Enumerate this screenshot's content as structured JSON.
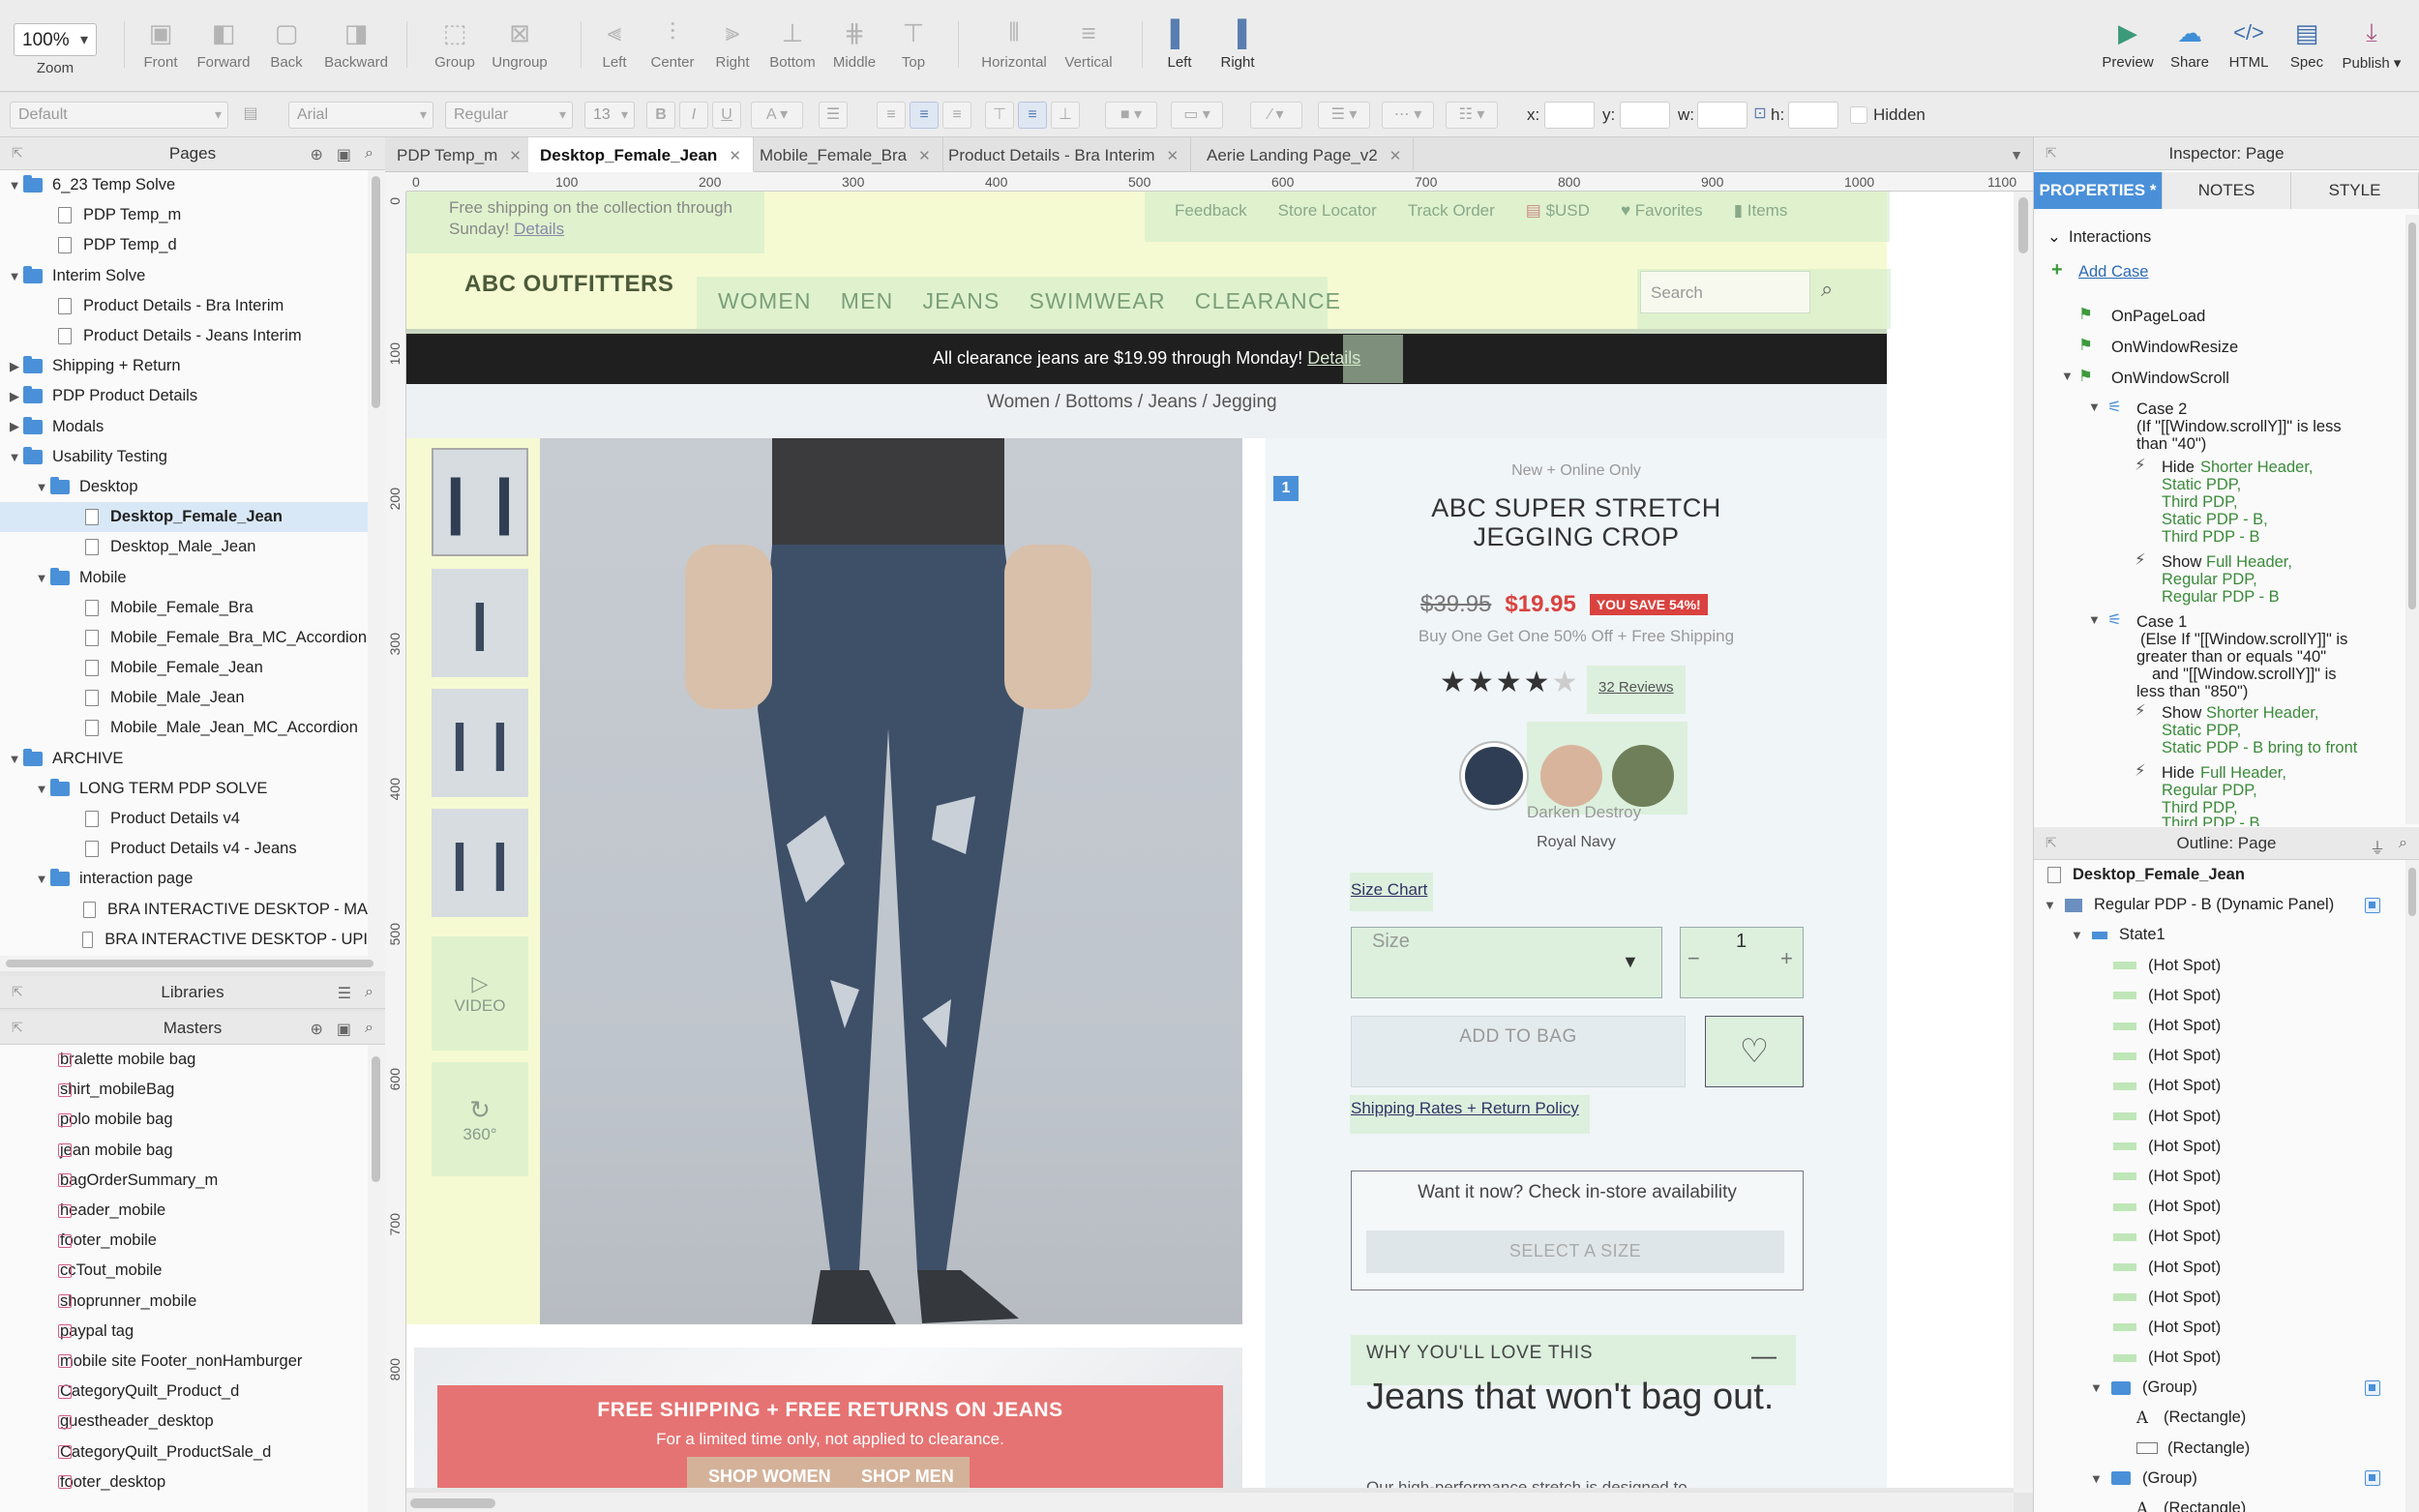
{
  "toolbar": {
    "zoom_value": "100%",
    "zoom_label": "Zoom",
    "arrange": [
      "Front",
      "Forward",
      "Back",
      "Backward"
    ],
    "group": [
      "Group",
      "Ungroup"
    ],
    "align": [
      "Left",
      "Center",
      "Right",
      "Bottom",
      "Middle",
      "Top"
    ],
    "distribute": [
      "Horizontal",
      "Vertical"
    ],
    "adaptive": [
      "Left",
      "Right"
    ],
    "publish": [
      "Preview",
      "Share",
      "HTML",
      "Spec",
      "Publish ▾"
    ]
  },
  "formatbar": {
    "style": "Default",
    "font": "Arial",
    "weight": "Regular",
    "size": "13",
    "x_label": "x:",
    "y_label": "y:",
    "w_label": "w:",
    "h_label": "h:",
    "hidden_label": "Hidden"
  },
  "pages_panel": {
    "title": "Pages",
    "items": [
      {
        "label": "6_23 Temp Solve",
        "level": 0,
        "type": "folder",
        "open": true
      },
      {
        "label": "PDP Temp_m",
        "level": 1,
        "type": "page"
      },
      {
        "label": "PDP Temp_d",
        "level": 1,
        "type": "page"
      },
      {
        "label": "Interim Solve",
        "level": 0,
        "type": "folder",
        "open": true
      },
      {
        "label": "Product Details - Bra Interim",
        "level": 1,
        "type": "page"
      },
      {
        "label": "Product Details - Jeans Interim",
        "level": 1,
        "type": "page"
      },
      {
        "label": "Shipping + Return",
        "level": 0,
        "type": "folder",
        "open": false
      },
      {
        "label": "PDP Product Details",
        "level": 0,
        "type": "folder",
        "open": false
      },
      {
        "label": "Modals",
        "level": 0,
        "type": "folder",
        "open": false
      },
      {
        "label": "Usability Testing",
        "level": 0,
        "type": "folder",
        "open": true
      },
      {
        "label": "Desktop",
        "level": 1,
        "type": "folder",
        "open": true
      },
      {
        "label": "Desktop_Female_Jean",
        "level": 2,
        "type": "page",
        "selected": true
      },
      {
        "label": "Desktop_Male_Jean",
        "level": 2,
        "type": "page"
      },
      {
        "label": "Mobile",
        "level": 1,
        "type": "folder",
        "open": true
      },
      {
        "label": "Mobile_Female_Bra",
        "level": 2,
        "type": "page"
      },
      {
        "label": "Mobile_Female_Bra_MC_Accordion",
        "level": 2,
        "type": "page"
      },
      {
        "label": "Mobile_Female_Jean",
        "level": 2,
        "type": "page"
      },
      {
        "label": "Mobile_Male_Jean",
        "level": 2,
        "type": "page"
      },
      {
        "label": "Mobile_Male_Jean_MC_Accordion",
        "level": 2,
        "type": "page"
      },
      {
        "label": "ARCHIVE",
        "level": 0,
        "type": "folder",
        "open": true
      },
      {
        "label": "LONG TERM PDP SOLVE",
        "level": 1,
        "type": "folder",
        "open": true
      },
      {
        "label": "Product Details v4",
        "level": 2,
        "type": "page"
      },
      {
        "label": "Product Details v4 - Jeans",
        "level": 2,
        "type": "page"
      },
      {
        "label": "interaction page",
        "level": 1,
        "type": "folder",
        "open": true
      },
      {
        "label": "BRA INTERACTIVE DESKTOP - MA",
        "level": 2,
        "type": "page"
      },
      {
        "label": "BRA INTERACTIVE DESKTOP - UPI",
        "level": 2,
        "type": "page"
      }
    ]
  },
  "libraries_panel": {
    "title": "Libraries"
  },
  "masters_panel": {
    "title": "Masters",
    "items": [
      "bralette mobile bag",
      "shirt_mobileBag",
      "polo mobile bag",
      "jean mobile bag",
      "bagOrderSummary_m",
      "header_mobile",
      "footer_mobile",
      "ccTout_mobile",
      "shoprunner_mobile",
      "paypal tag",
      "mobile site Footer_nonHamburger",
      "CategoryQuilt_Product_d",
      "guestheader_desktop",
      "CategoryQuilt_ProductSale_d",
      "footer_desktop"
    ]
  },
  "tabs": [
    {
      "label": "PDP Temp_m",
      "active": false
    },
    {
      "label": "Desktop_Female_Jean",
      "active": true
    },
    {
      "label": "Mobile_Female_Bra",
      "active": false
    },
    {
      "label": "Product Details - Bra Interim",
      "active": false
    },
    {
      "label": "Aerie Landing Page_v2",
      "active": false
    }
  ],
  "ruler": {
    "h": [
      "0",
      "100",
      "200",
      "300",
      "400",
      "500",
      "600",
      "700",
      "800",
      "900",
      "1000",
      "1100"
    ],
    "v": [
      "0",
      "100",
      "200",
      "300",
      "400",
      "500",
      "600",
      "700",
      "800"
    ]
  },
  "design": {
    "promo_text": "Free shipping on the collection through Sunday!",
    "promo_link": "Details",
    "util_links": [
      "Feedback",
      "Store Locator",
      "Track Order",
      "$USD",
      "Favorites",
      "Items"
    ],
    "logo": "ABC OUTFITTERS",
    "nav": [
      "WOMEN",
      "MEN",
      "JEANS",
      "SWIMWEAR",
      "CLEARANCE"
    ],
    "search_placeholder": "Search",
    "banner_text": "All clearance jeans are $19.99 through Monday!",
    "banner_link": "Details",
    "breadcrumb": "Women / Bottoms / Jeans / Jegging",
    "thumb_video": "VIDEO",
    "thumb_360": "360°",
    "badge": "1",
    "tagline": "New + Online Only",
    "product_title": "ABC SUPER STRETCH JEGGING CROP",
    "price_old": "$39.95",
    "price_new": "$19.95",
    "save": "YOU SAVE 54%!",
    "offer": "Buy One Get One 50% Off + Free Shipping",
    "rating": 4,
    "reviews": "32 Reviews",
    "swatch_hover": "Darken Destroy",
    "swatch_selected": "Royal Navy",
    "size_chart": "Size Chart",
    "size_placeholder": "Size",
    "qty": "1",
    "add_to_bag": "ADD TO BAG",
    "shipping_link": "Shipping Rates + Return Policy",
    "instore_title": "Want it now? Check in-store availability",
    "select_size": "SELECT A SIZE",
    "why_title": "WHY YOU'LL LOVE THIS",
    "why_headline": "Jeans that won't bag out.",
    "why_body": "Our high-performance stretch is designed to",
    "promo2_title": "FREE SHIPPING + FREE RETURNS ON JEANS",
    "promo2_sub": "For a limited time only, not applied to clearance.",
    "promo2_btn1": "SHOP WOMEN",
    "promo2_btn2": "SHOP MEN",
    "colors": {
      "banner": "#1f1f1f",
      "sale": "#d9423f",
      "promo_red": "#e67373",
      "header_yellow": "#f6fad2",
      "hotspot": "#cfeccb"
    }
  },
  "inspector": {
    "title": "Inspector: Page",
    "tabs": [
      "PROPERTIES *",
      "NOTES",
      "STYLE"
    ],
    "section": "Interactions",
    "add_case": "Add Case",
    "events": [
      "OnPageLoad",
      "OnWindowResize",
      "OnWindowScroll"
    ],
    "case2": {
      "title": "Case 2",
      "cond": [
        "(If \"[[Window.scrollY]]\" is less",
        "than \"40\")"
      ],
      "hide_label": "Hide",
      "hide_items": [
        "Shorter Header,",
        "Static PDP,",
        "Third PDP,",
        "Static PDP - B,",
        "Third PDP - B"
      ],
      "show_label": "Show",
      "show_items": [
        "Full Header,",
        "Regular PDP,",
        "Regular PDP - B"
      ]
    },
    "case1": {
      "title": "Case 1",
      "cond": [
        "(Else If \"[[Window.scrollY]]\" is",
        "greater than or equals \"40\"",
        "and \"[[Window.scrollY]]\" is",
        "less than \"850\")"
      ],
      "show_label": "Show",
      "show_items": [
        "Shorter Header,",
        "Static PDP,",
        "Static PDP - B bring to front"
      ],
      "hide_label": "Hide",
      "hide_items": [
        "Full Header,",
        "Regular PDP,",
        "Third PDP,",
        "Third PDP - B"
      ]
    }
  },
  "outline": {
    "title": "Outline: Page",
    "root": "Desktop_Female_Jean",
    "panel": "Regular PDP - B (Dynamic Panel)",
    "state": "State1",
    "hotspot": "(Hot Spot)",
    "hotspot_count": 14,
    "group": "(Group)",
    "rect": "(Rectangle)"
  }
}
